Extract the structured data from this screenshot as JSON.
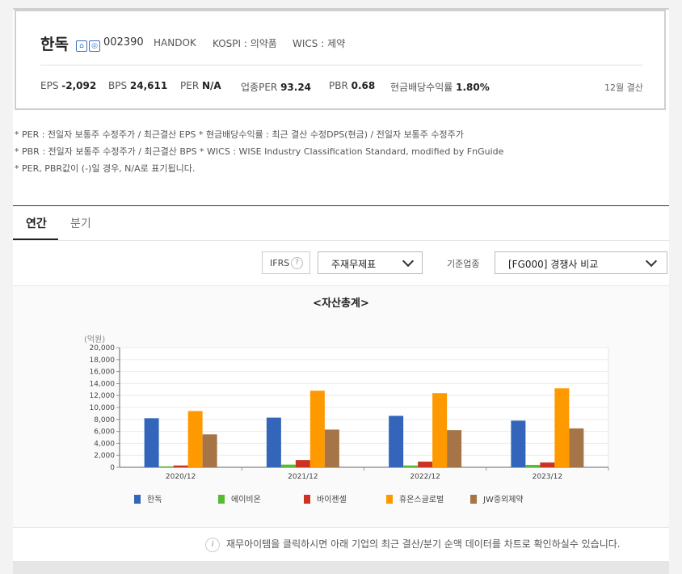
{
  "summary": {
    "name": "한독",
    "icon1": "home-icon",
    "icon2": "ir-icon",
    "code": "002390",
    "en_name": "HANDOK",
    "market": "KOSPI : 의약품",
    "wics": "WICS : 제약",
    "metrics": [
      {
        "label": "EPS",
        "value": "-2,092"
      },
      {
        "label": "BPS",
        "value": "24,611"
      },
      {
        "label": "PER",
        "value": "N/A"
      },
      {
        "label": "업종PER",
        "value": "93.24"
      },
      {
        "label": "PBR",
        "value": "0.68"
      },
      {
        "label": "현금배당수익률",
        "value": "1.80%"
      }
    ],
    "settle": "12월 결산"
  },
  "notes": [
    "* PER : 전일자 보통주 수정주가 / 최근결산 EPS * 현금배당수익률 : 최근 결산 수정DPS(현금) / 전일자 보통주 수정주가",
    "* PBR : 전일자 보통주 수정주가 / 최근결산 BPS * WICS : WISE Industry Classification Standard, modified by FnGuide",
    "* PER, PBR값이 (-)일 경우, N/A로 표기됩니다."
  ],
  "tabs": [
    {
      "label": "연간"
    },
    {
      "label": "분기"
    }
  ],
  "controls": {
    "ifrs_label": "IFRS",
    "help_glyph": "?",
    "statement_select": "주재무제표",
    "std_label": "기준업종",
    "industry_select": "[FG000] 경쟁사 비교"
  },
  "info_text": "재무아이템을 클릭하시면 아래 기업의 최근 결산/분기 순액 데이터를 차트로 확인하실수 있습니다.",
  "info_glyph": "i",
  "chart_data": {
    "type": "bar",
    "title": "<자산총계>",
    "ylabel": "(억원)",
    "ylim": [
      0,
      20000
    ],
    "yticks": [
      "0",
      "2,000",
      "4,000",
      "6,000",
      "8,000",
      "10,000",
      "12,000",
      "14,000",
      "16,000",
      "18,000",
      "20,000"
    ],
    "categories": [
      "2020/12",
      "2021/12",
      "2022/12",
      "2023/12"
    ],
    "series": [
      {
        "name": "한독",
        "color": "#3366bb",
        "values": [
          8200,
          8300,
          8600,
          7800
        ]
      },
      {
        "name": "에이비온",
        "color": "#55bb33",
        "values": [
          150,
          450,
          300,
          400
        ]
      },
      {
        "name": "바이젠셀",
        "color": "#cc3322",
        "values": [
          300,
          1200,
          950,
          800
        ]
      },
      {
        "name": "휴온스글로벌",
        "color": "#ff9900",
        "values": [
          9400,
          12800,
          12400,
          13200
        ]
      },
      {
        "name": "JW중외제약",
        "color": "#a57548",
        "values": [
          5500,
          6300,
          6200,
          6500
        ]
      }
    ],
    "grid": true,
    "legend": "bottom"
  }
}
